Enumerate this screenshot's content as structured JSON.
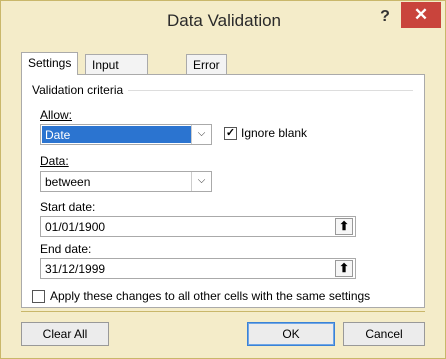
{
  "window": {
    "title": "Data Validation",
    "help_glyph": "?",
    "close_glyph": "✕"
  },
  "tabs": [
    {
      "label": "Settings",
      "active": true
    },
    {
      "label": "Input Message",
      "active": false
    },
    {
      "label": "Error Alert",
      "active": false
    }
  ],
  "settings": {
    "criteria_label": "Validation criteria",
    "allow_label": "Allow:",
    "allow_value": "Date",
    "ignore_blank_label": "Ignore blank",
    "ignore_blank_checked": true,
    "data_label": "Data:",
    "data_value": "between",
    "start_label": "Start date:",
    "start_value": "01/01/1900",
    "end_label": "End date:",
    "end_value": "31/12/1999",
    "apply_label": "Apply these changes to all other cells with the same settings",
    "apply_checked": false
  },
  "buttons": {
    "clear_all": "Clear All",
    "ok": "OK",
    "cancel": "Cancel"
  },
  "colors": {
    "frame": "#f4ecc9",
    "close_button": "#c9443c",
    "selection": "#2b74d0"
  }
}
